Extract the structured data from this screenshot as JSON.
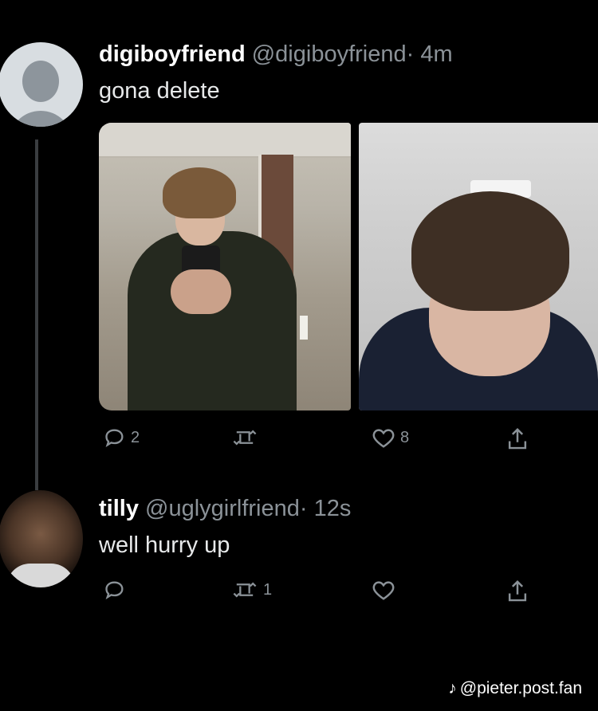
{
  "tweet1": {
    "display_name": "digiboyfriend",
    "handle": "@digiboyfriend",
    "time": "· 4m",
    "text": "gona delete",
    "replies": "2",
    "retweets": "",
    "likes": "8"
  },
  "tweet2": {
    "display_name": "tilly",
    "handle": "@uglygirlfriend",
    "time": "· 12s",
    "text": "well hurry up",
    "replies": "",
    "retweets": "1",
    "likes": ""
  },
  "attribution": {
    "icon": "tiktok-icon",
    "text": "@pieter.post.fan"
  },
  "colors": {
    "background": "#000000",
    "text": "#e7e9ea",
    "muted": "#8b9298"
  }
}
